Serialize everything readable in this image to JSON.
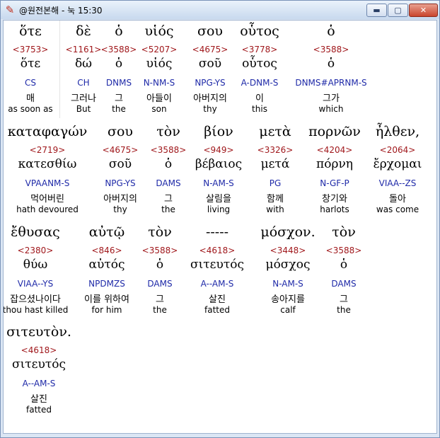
{
  "window": {
    "title": "@원전본해 - 눅 15:30",
    "min_label": "▬",
    "max_label": "▢",
    "close_label": "✕"
  },
  "rows": [
    {
      "words": [
        {
          "greek": "ὅτε",
          "strong": "<3753>",
          "lemma": "ὅτε",
          "parse": "CS",
          "korean": "매",
          "english": "as soon as"
        },
        {
          "greek": "δὲ",
          "strong": "<1161>",
          "lemma": "δώ",
          "parse": "CH",
          "korean": "그러나",
          "english": "But"
        },
        {
          "greek": "ὁ",
          "strong": "<3588>",
          "lemma": "ὁ",
          "parse": "DNMS",
          "korean": "그",
          "english": "the"
        },
        {
          "greek": "υἱός",
          "strong": "<5207>",
          "lemma": "υἱός",
          "parse": "N-NM-S",
          "korean": "아들이",
          "english": "son"
        },
        {
          "greek": "σου",
          "strong": "<4675>",
          "lemma": "σοῦ",
          "parse": "NPG-YS",
          "korean": "아버지의",
          "english": "thy"
        },
        {
          "greek": "οὗτος",
          "strong": "<3778>",
          "lemma": "οὗτος",
          "parse": "A-DNM-S",
          "korean": "이",
          "english": "this"
        },
        {
          "greek": "ὁ",
          "strong": "<3588>",
          "lemma": "ὁ",
          "parse": "DNMS#APRNM-S",
          "korean": "그가",
          "english": "which"
        }
      ]
    },
    {
      "words": [
        {
          "greek": "καταφαγών",
          "strong": "<2719>",
          "lemma": "κατεσθίω",
          "parse": "VPAANM-S",
          "korean": "먹어버린",
          "english": "hath devoured"
        },
        {
          "greek": "σου",
          "strong": "<4675>",
          "lemma": "σοῦ",
          "parse": "NPG-YS",
          "korean": "아버지의",
          "english": "thy"
        },
        {
          "greek": "τὸν",
          "strong": "<3588>",
          "lemma": "ὁ",
          "parse": "DAMS",
          "korean": "그",
          "english": "the"
        },
        {
          "greek": "βίον",
          "strong": "<949>",
          "lemma": "βέβαιος",
          "parse": "N-AM-S",
          "korean": "살림을",
          "english": "living"
        },
        {
          "greek": "μετὰ",
          "strong": "<3326>",
          "lemma": "μετά",
          "parse": "PG",
          "korean": "함께",
          "english": "with"
        },
        {
          "greek": "πορνῶν",
          "strong": "<4204>",
          "lemma": "πόρνη",
          "parse": "N-GF-P",
          "korean": "창기와",
          "english": "harlots"
        },
        {
          "greek": "ἦλθεν,",
          "strong": "<2064>",
          "lemma": "ἔρχομαι",
          "parse": "VIAA--ZS",
          "korean": "돌아",
          "english": "was come"
        }
      ]
    },
    {
      "words": [
        {
          "greek": "ἔθυσας",
          "strong": "<2380>",
          "lemma": "θύω",
          "parse": "VIAA--YS",
          "korean": "잡으셨나이다",
          "english": "thou hast killed"
        },
        {
          "greek": "αὐτῷ",
          "strong": "<846>",
          "lemma": "αὐτός",
          "parse": "NPDMZS",
          "korean": "이를 위하여",
          "english": "for him"
        },
        {
          "greek": "τὸν",
          "strong": "<3588>",
          "lemma": "ὁ",
          "parse": "DAMS",
          "korean": "그",
          "english": "the"
        },
        {
          "greek": "-----",
          "strong": "<4618>",
          "lemma": "σιτευτός",
          "parse": "A--AM-S",
          "korean": "살진",
          "english": "fatted"
        },
        {
          "greek": "μόσχον.",
          "strong": "<3448>",
          "lemma": "μόσχος",
          "parse": "N-AM-S",
          "korean": "송아지를",
          "english": "calf"
        },
        {
          "greek": "τὸν",
          "strong": "<3588>",
          "lemma": "ὁ",
          "parse": "DAMS",
          "korean": "그",
          "english": "the"
        }
      ]
    },
    {
      "words": [
        {
          "greek": "σιτευτὸν.",
          "strong": "<4618>",
          "lemma": "σιτευτός",
          "parse": "A--AM-S",
          "korean": "살진",
          "english": "fatted"
        }
      ]
    }
  ]
}
